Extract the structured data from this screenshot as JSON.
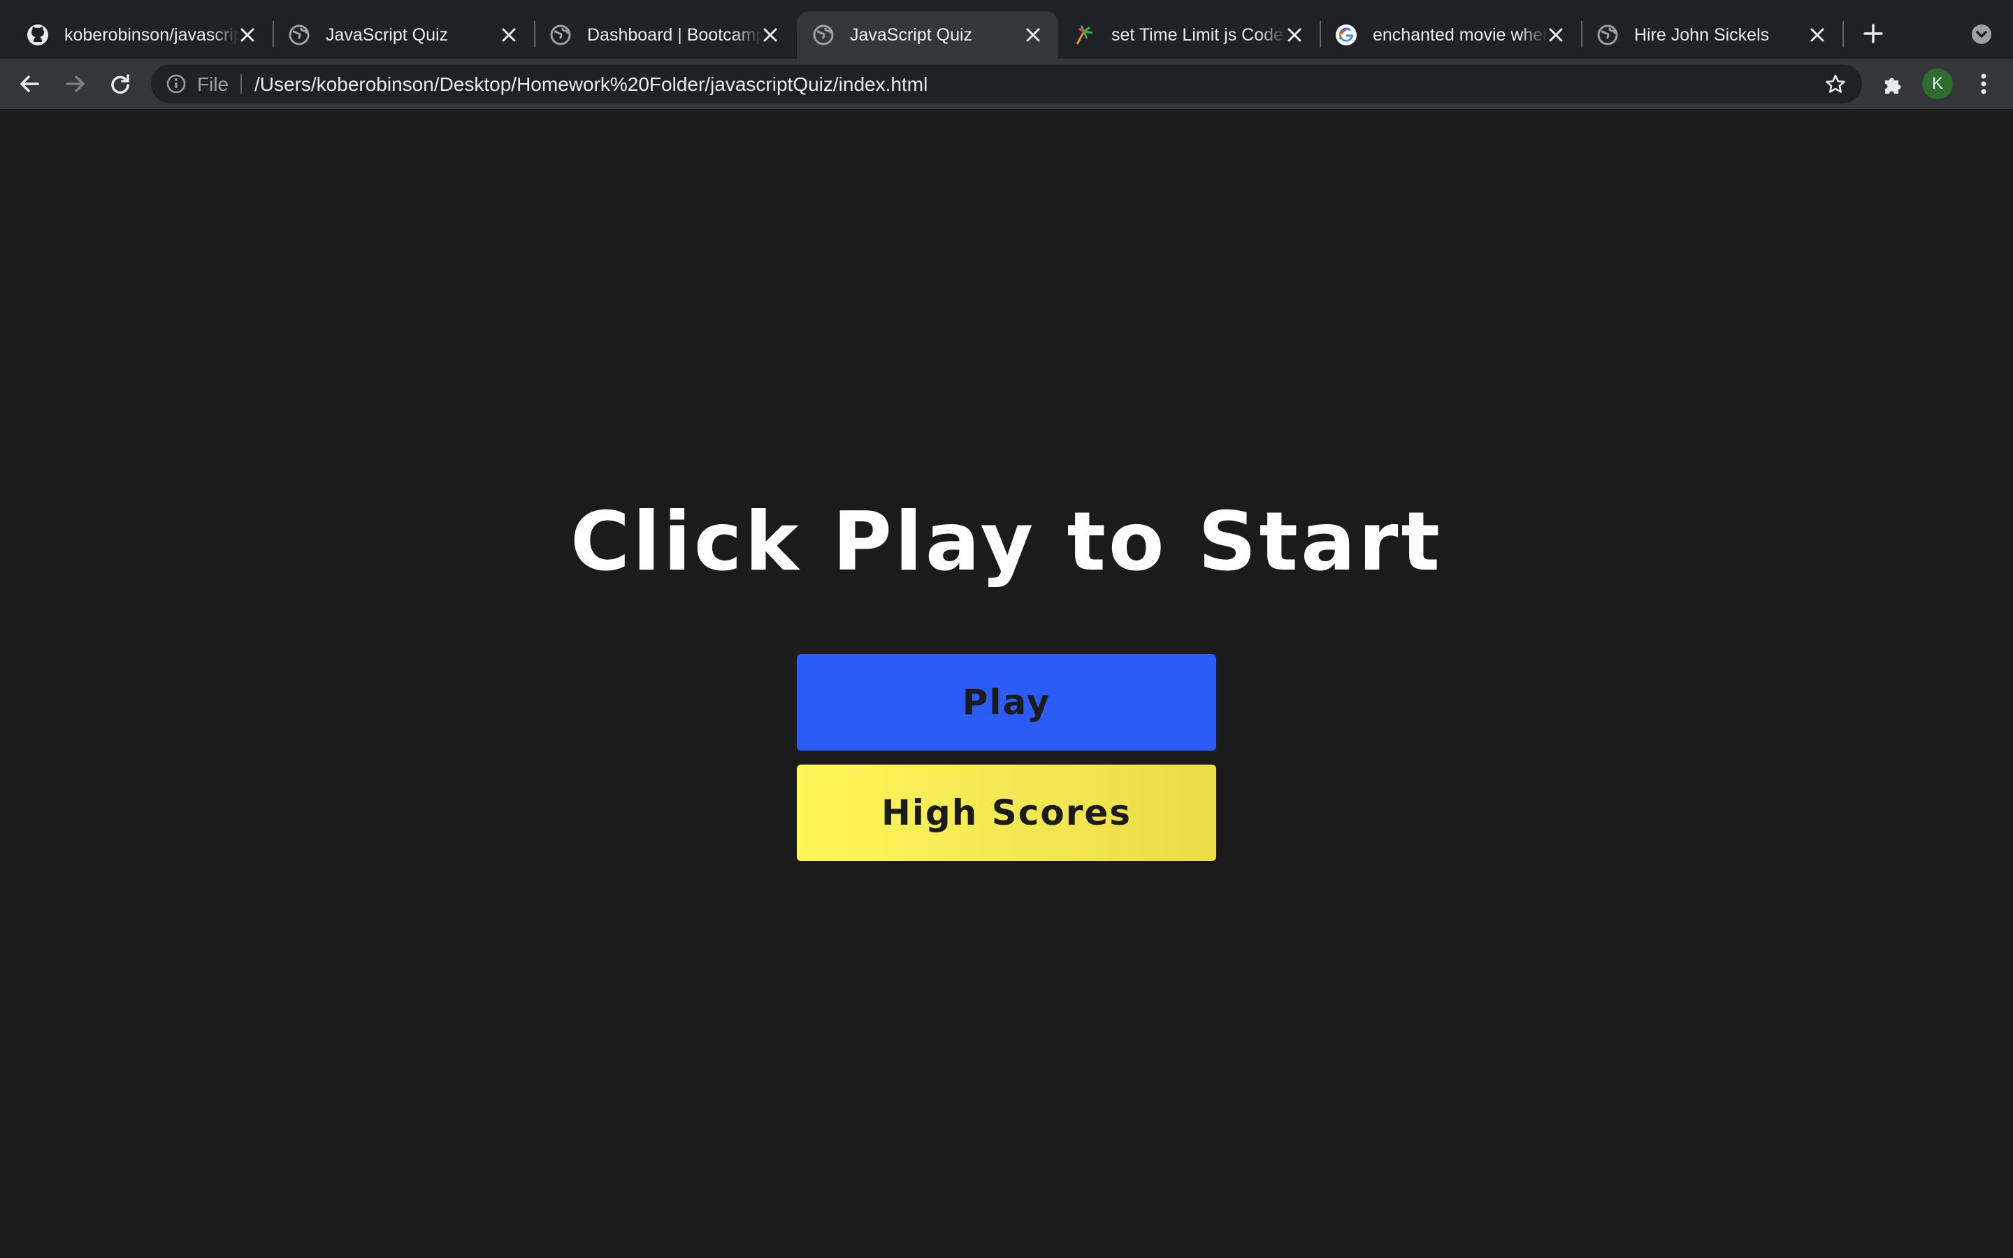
{
  "browser": {
    "tabs": [
      {
        "title": "koberobinson/javascriptQuiz",
        "icon": "github-icon",
        "active": false
      },
      {
        "title": "JavaScript Quiz",
        "icon": "globe-icon",
        "active": false
      },
      {
        "title": "Dashboard | Bootcamp Spot",
        "icon": "globe-icon",
        "active": false
      },
      {
        "title": "JavaScript Quiz",
        "icon": "globe-icon",
        "active": true
      },
      {
        "title": "set Time Limit js Code",
        "icon": "grepper-icon",
        "active": false
      },
      {
        "title": "enchanted movie where",
        "icon": "google-icon",
        "active": false
      },
      {
        "title": "Hire John Sickels",
        "icon": "globe-icon",
        "active": false
      }
    ],
    "omnibox": {
      "scheme_label": "File",
      "url": "/Users/koberobinson/Desktop/Homework%20Folder/javascriptQuiz/index.html"
    },
    "profile_initial": "K",
    "colors": {
      "tabstrip": "#202124",
      "toolbar": "#35363a",
      "omnibox": "#202124",
      "avatar": "#2e6b2f"
    }
  },
  "page": {
    "heading": "Click Play to Start",
    "play_label": "Play",
    "high_scores_label": "High Scores",
    "colors": {
      "background": "#1c1b1b",
      "play": "#2b5cf6",
      "high_scores": "#fdf65a"
    }
  }
}
